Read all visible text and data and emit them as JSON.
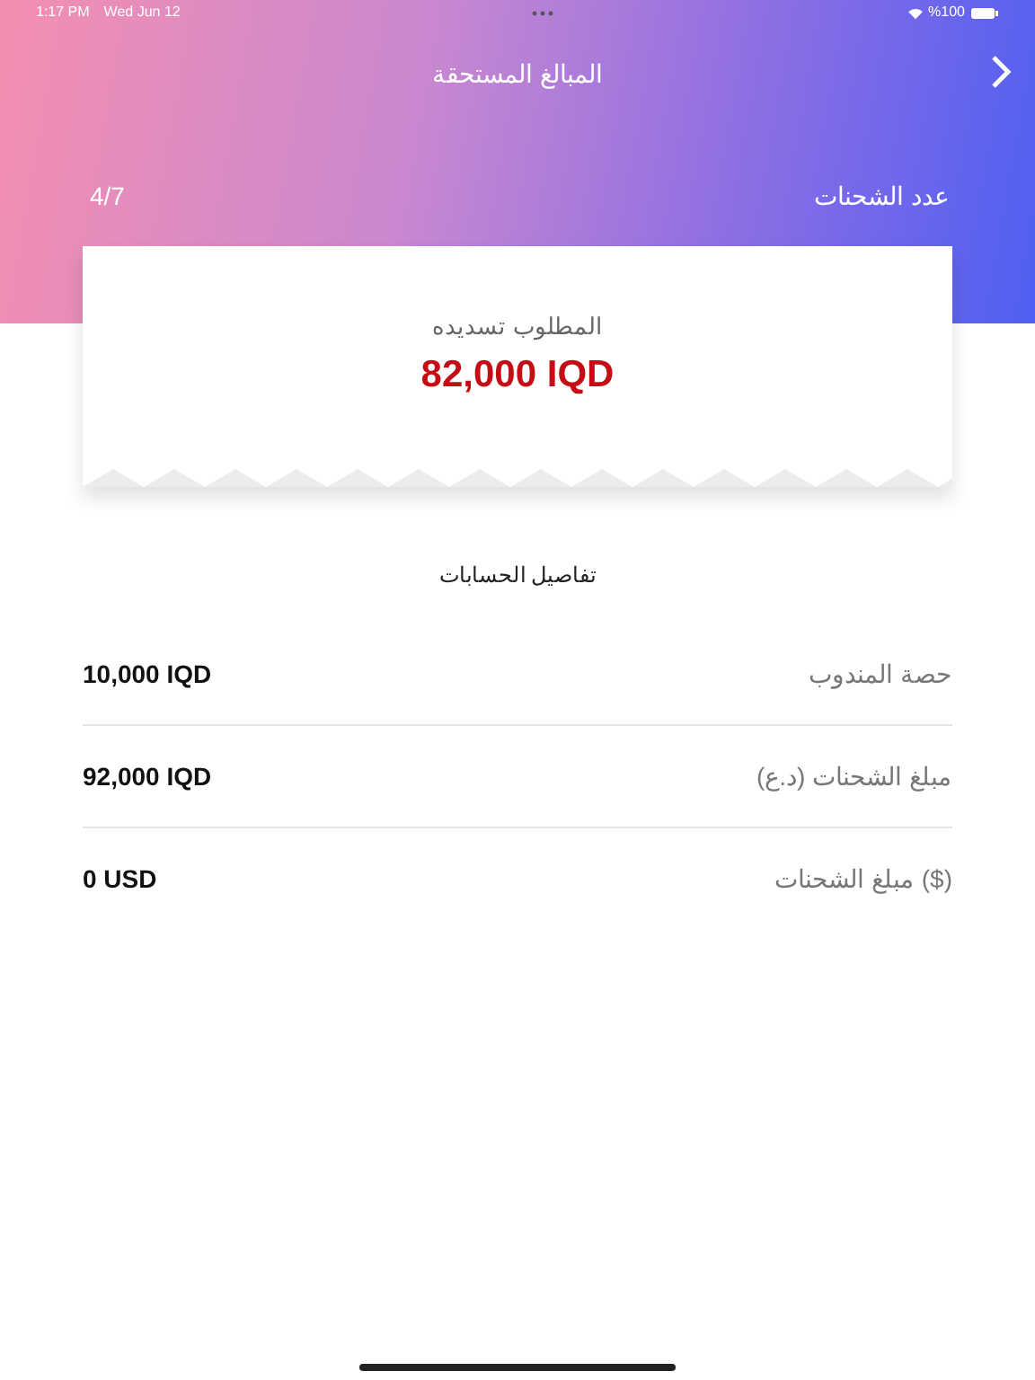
{
  "status_bar": {
    "time": "1:17 PM",
    "date": "Wed Jun 12",
    "battery": "%100"
  },
  "nav": {
    "title": "المبالغ المستحقة"
  },
  "shipments": {
    "label": "عدد الشحنات",
    "value": "4/7"
  },
  "due": {
    "label": "المطلوب تسديده",
    "amount": "82,000 IQD"
  },
  "details": {
    "title": "تفاصيل الحسابات",
    "rows": [
      {
        "label": "حصة المندوب",
        "value": "10,000 IQD"
      },
      {
        "label": "مبلغ الشحنات (د.ع)",
        "value": "92,000 IQD"
      },
      {
        "label": "مبلغ الشحنات ($)",
        "value": "0 USD"
      }
    ]
  }
}
